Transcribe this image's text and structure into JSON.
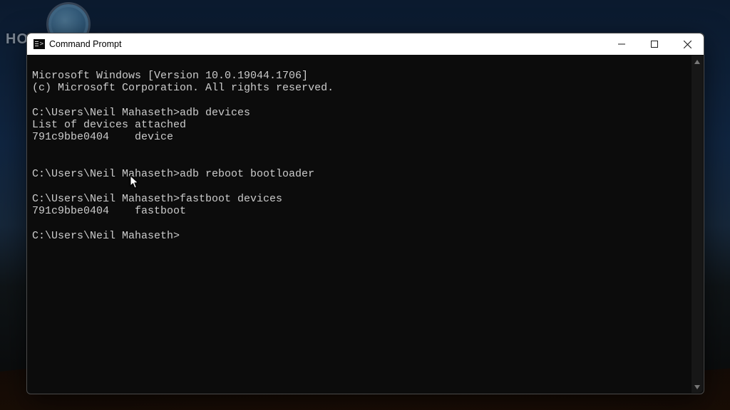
{
  "watermark": {
    "text": "HOWISOLVE.COM"
  },
  "window": {
    "title": "Command Prompt",
    "controls": {
      "minimize": "Minimize",
      "maximize": "Maximize",
      "close": "Close"
    }
  },
  "terminal": {
    "lines": [
      "Microsoft Windows [Version 10.0.19044.1706]",
      "(c) Microsoft Corporation. All rights reserved.",
      "",
      "C:\\Users\\Neil Mahaseth>adb devices",
      "List of devices attached",
      "791c9bbe0404    device",
      "",
      "",
      "C:\\Users\\Neil Mahaseth>adb reboot bootloader",
      "",
      "C:\\Users\\Neil Mahaseth>fastboot devices",
      "791c9bbe0404    fastboot",
      "",
      "C:\\Users\\Neil Mahaseth>"
    ]
  }
}
